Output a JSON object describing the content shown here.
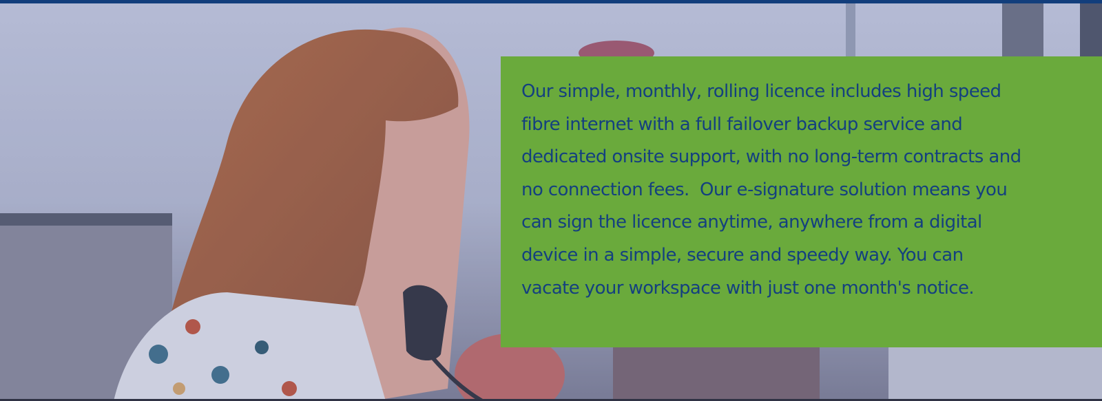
{
  "colors": {
    "top_bar": "#123e7c",
    "panel_background": "#6aaa3c",
    "panel_text": "#14407f",
    "photo_overlay": "#5a6a9c"
  },
  "hero": {
    "image": "woman-on-phone-photo",
    "lines": [
      "Our simple, monthly, rolling licence includes high speed",
      "fibre internet with a full failover backup service and",
      "dedicated onsite support, with no long-term contracts and",
      "no connection fees.  Our e-signature solution means you",
      "can sign the licence anytime, anywhere from a digital",
      "device in a simple, secure and speedy way. You can",
      "vacate your workspace with just one month's notice."
    ]
  }
}
